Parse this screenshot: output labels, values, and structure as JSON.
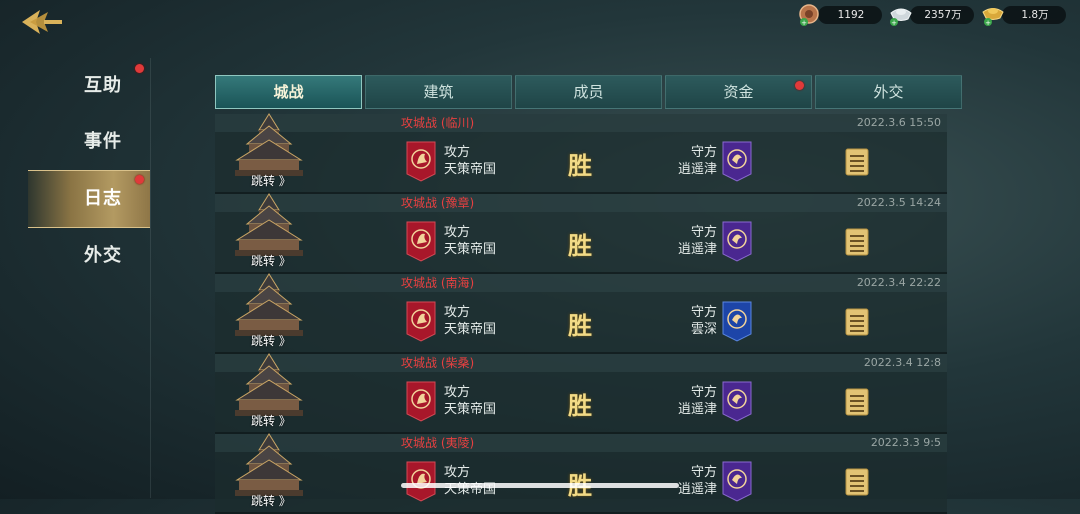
{
  "currencies": [
    {
      "name": "copper-coin",
      "value": "1192",
      "color": "#c98a55"
    },
    {
      "name": "silver-ingot",
      "value": "2357万",
      "color": "#c7d1d6"
    },
    {
      "name": "gold-ingot",
      "value": "1.8万",
      "color": "#e2b44a"
    }
  ],
  "menu": {
    "items": [
      {
        "label": "互助",
        "dot": true
      },
      {
        "label": "事件",
        "dot": false
      },
      {
        "label": "日志",
        "dot": true,
        "active": true
      },
      {
        "label": "外交",
        "dot": false
      }
    ]
  },
  "tabs": [
    {
      "label": "城战",
      "active": true
    },
    {
      "label": "建筑"
    },
    {
      "label": "成员"
    },
    {
      "label": "资金",
      "dot": true
    },
    {
      "label": "外交"
    }
  ],
  "battles": [
    {
      "title": "攻城战 (临川)",
      "time": "2022.3.6 15:50",
      "jump": "跳转 》",
      "attacker_label": "攻方",
      "attacker": "天策帝国",
      "result": "胜",
      "defender_label": "守方",
      "defender": "逍遥津",
      "defender_banner": "purple"
    },
    {
      "title": "攻城战 (豫章)",
      "time": "2022.3.5 14:24",
      "jump": "跳转 》",
      "attacker_label": "攻方",
      "attacker": "天策帝国",
      "result": "胜",
      "defender_label": "守方",
      "defender": "逍遥津",
      "defender_banner": "purple"
    },
    {
      "title": "攻城战 (南海)",
      "time": "2022.3.4 22:22",
      "jump": "跳转 》",
      "attacker_label": "攻方",
      "attacker": "天策帝国",
      "result": "胜",
      "defender_label": "守方",
      "defender": "雲深",
      "defender_banner": "blue"
    },
    {
      "title": "攻城战 (柴桑)",
      "time": "2022.3.4 12:8",
      "jump": "跳转 》",
      "attacker_label": "攻方",
      "attacker": "天策帝国",
      "result": "胜",
      "defender_label": "守方",
      "defender": "逍遥津",
      "defender_banner": "purple"
    },
    {
      "title": "攻城战 (夷陵)",
      "time": "2022.3.3 9:5",
      "jump": "跳转 》",
      "attacker_label": "攻方",
      "attacker": "天策帝国",
      "result": "胜",
      "defender_label": "守方",
      "defender": "逍遥津",
      "defender_banner": "purple"
    }
  ],
  "colors": {
    "attacker_banner": "#a8172a",
    "defender_purple": "#4a2790",
    "defender_blue": "#1d45a8",
    "victory": "#f3db86",
    "title_red": "#e84040"
  }
}
